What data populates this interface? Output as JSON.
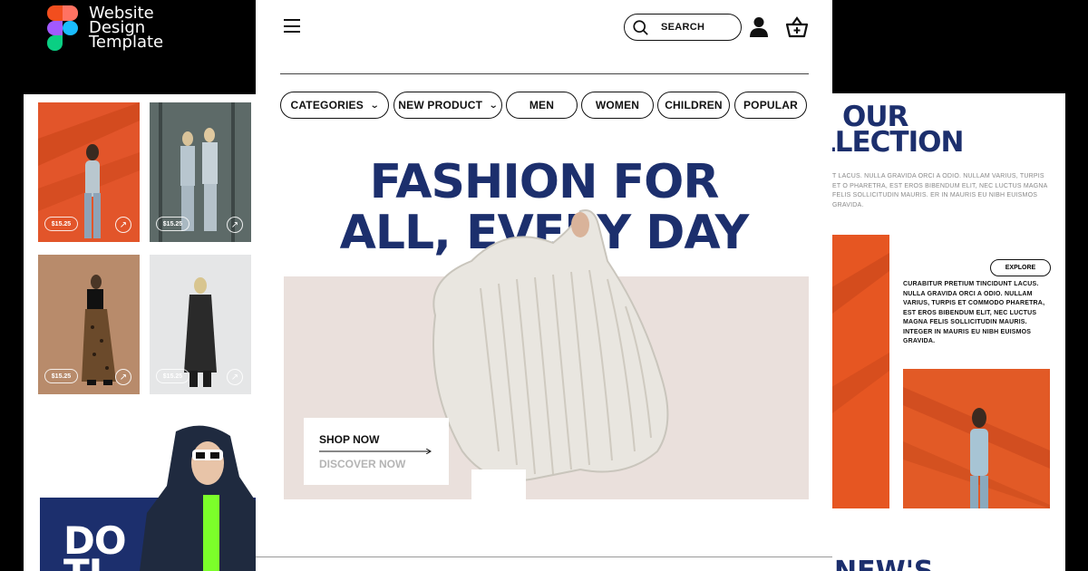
{
  "brand": {
    "line1": "Website",
    "line2": "Design",
    "line3": "Template"
  },
  "header": {
    "search_label": "SEARCH",
    "icons": [
      "menu-icon",
      "search-icon",
      "user-icon",
      "cart-icon"
    ]
  },
  "nav": {
    "categories": "CATEGORIES",
    "new_product": "NEW PRODUCT",
    "men": "MEN",
    "women": "WOMEN",
    "children": "CHILDREN",
    "popular": "POPULAR"
  },
  "hero": {
    "title_line1": "FASHION FOR",
    "title_line2": "ALL, EVERY DAY",
    "shop_now": "SHOP NOW",
    "discover_now": "DISCOVER NOW"
  },
  "products": [
    {
      "price": "$15.25"
    },
    {
      "price": "$15.25"
    },
    {
      "price": "$15.25"
    },
    {
      "price": "$15.25"
    }
  ],
  "promo": {
    "line1": "DO",
    "line2": "TI"
  },
  "collection": {
    "title_line1": "OUR",
    "title_line2": "LLECTION",
    "description": "T LACUS. NULLA GRAVIDA ORCI A ODIO. NULLAM VARIUS, TURPIS ET O PHARETRA, EST EROS BIBENDUM ELIT, NEC LUCTUS MAGNA FELIS SOLLICITUDIN MAURIS. ER IN MAURIS EU NIBH EUISMOS GRAVIDA.",
    "explore": "EXPLORE",
    "side_text": "CURABITUR PRETIUM TINCIDUNT LACUS. NULLA GRAVIDA ORCI A ODIO. NULLAM VARIUS, TURPIS ET COMMODO PHARETRA, EST EROS BIBENDUM ELIT, NEC LUCTUS MAGNA FELIS SOLLICITUDIN MAURIS. INTEGER IN MAURIS EU NIBH EUISMOS GRAVIDA.",
    "news_heading": "NEW'S"
  },
  "colors": {
    "navy": "#1c2f6d",
    "orange": "#e65622",
    "hero_bg": "#eae0dc"
  }
}
